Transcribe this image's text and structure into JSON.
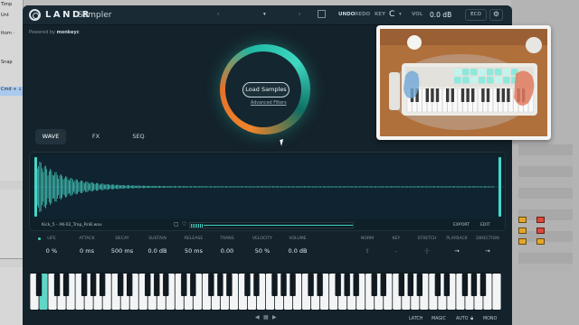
{
  "daw_sidebar": {
    "rows": [
      "Timp",
      "Unt",
      "ttom ·",
      "",
      "Snap",
      "",
      "Cmd + ↓",
      "",
      "",
      "",
      "",
      "",
      ""
    ]
  },
  "app": {
    "brand": "LANDR",
    "product": "Sampler",
    "powered_by_prefix": "Powered by",
    "powered_by_name": "monkeyc",
    "toolbar": {
      "undo": "UNDO",
      "redo": "REDO",
      "key_label": "KEY",
      "key_value": "C",
      "vol_label": "VOL",
      "vol_value": "0.0 dB",
      "eco": "ECO"
    }
  },
  "loader": {
    "button": "Load Samples",
    "link": "Advanced Filters"
  },
  "tabs": [
    {
      "label": "WAVE",
      "active": true
    },
    {
      "label": "FX",
      "active": false
    },
    {
      "label": "SEQ",
      "active": false
    }
  ],
  "wave": {
    "filename": "Kick_5 - AK-02_Trap_RnB.wav",
    "export": "EXPORT",
    "edit": "EDIT",
    "accent_color": "#48d6c6"
  },
  "controls": [
    {
      "label": "LIFE",
      "value": "0 %",
      "on": true
    },
    {
      "label": "ATTACK",
      "value": "0 ms"
    },
    {
      "label": "DECAY",
      "value": "500 ms"
    },
    {
      "label": "SUSTAIN",
      "value": "0.0 dB"
    },
    {
      "label": "RELEASE",
      "value": "50 ms"
    },
    {
      "label": "TRANS",
      "value": "0.00"
    },
    {
      "label": "VELOCITY",
      "value": "50 %"
    },
    {
      "label": "VOLUME",
      "value": "0.0 dB"
    },
    {
      "label": "NORM",
      "value": "⇧",
      "dim": true
    },
    {
      "label": "KEY",
      "value": "-",
      "dim": true
    },
    {
      "label": "STRETCH",
      "value": "·|·",
      "dim": true
    },
    {
      "label": "PLAYBACK",
      "value": "→"
    },
    {
      "label": "DIRECTION",
      "value": "→"
    }
  ],
  "bottom": {
    "latch": "LATCH",
    "magic": "MAGIC",
    "auto": "AUTO",
    "auto_icon": "lock-icon",
    "mono": "MONO"
  },
  "colors": {
    "window_bg": "#14222b",
    "accent_teal": "#3fd9c3",
    "accent_orange": "#f0852b"
  }
}
